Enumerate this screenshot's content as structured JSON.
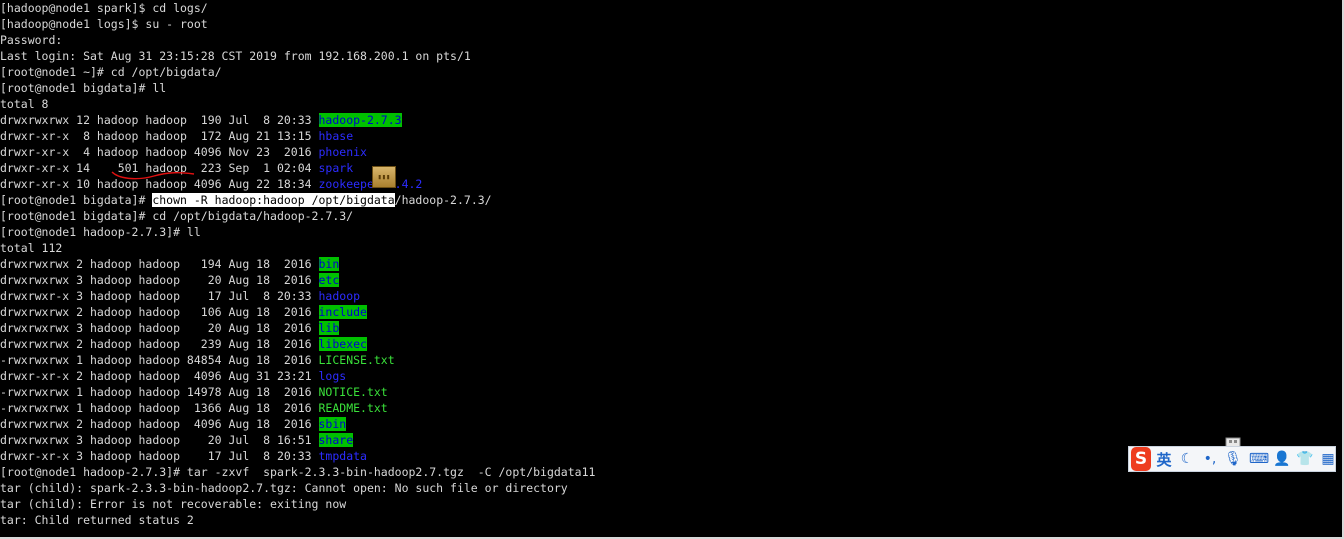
{
  "terminal": {
    "lines": [
      {
        "segments": [
          {
            "t": "[hadoop@node1 spark]$ cd logs/",
            "c": ""
          }
        ]
      },
      {
        "segments": [
          {
            "t": "[hadoop@node1 logs]$ su - root",
            "c": ""
          }
        ]
      },
      {
        "segments": [
          {
            "t": "Password:",
            "c": ""
          }
        ]
      },
      {
        "segments": [
          {
            "t": "Last login: Sat Aug 31 23:15:28 CST 2019 from 192.168.200.1 on pts/1",
            "c": ""
          }
        ]
      },
      {
        "segments": [
          {
            "t": "[root@node1 ~]# cd /opt/bigdata/",
            "c": ""
          }
        ]
      },
      {
        "segments": [
          {
            "t": "[root@node1 bigdata]# ll",
            "c": ""
          }
        ]
      },
      {
        "segments": [
          {
            "t": "total 8",
            "c": ""
          }
        ]
      },
      {
        "segments": [
          {
            "t": "drwxrwxrwx 12 hadoop hadoop  190 Jul  8 20:33 ",
            "c": ""
          },
          {
            "t": "hadoop-2.7.3",
            "c": "c-green-bg"
          }
        ]
      },
      {
        "segments": [
          {
            "t": "drwxr-xr-x  8 hadoop hadoop  172 Aug 21 13:15 ",
            "c": ""
          },
          {
            "t": "hbase",
            "c": "c-blue"
          }
        ]
      },
      {
        "segments": [
          {
            "t": "drwxr-xr-x  4 hadoop hadoop 4096 Nov 23  2016 ",
            "c": ""
          },
          {
            "t": "phoenix",
            "c": "c-blue"
          }
        ]
      },
      {
        "segments": [
          {
            "t": "drwxr-xr-x 14    501 hadoop  223 Sep  1 02:04 ",
            "c": ""
          },
          {
            "t": "spark",
            "c": "c-blue"
          }
        ]
      },
      {
        "segments": [
          {
            "t": "drwxr-xr-x 10 hadoop hadoop 4096 Aug 22 18:34 ",
            "c": ""
          },
          {
            "t": "zookeeper-3.4.2",
            "c": "c-blue"
          }
        ]
      },
      {
        "segments": [
          {
            "t": "[root@node1 bigdata]# ",
            "c": ""
          },
          {
            "t": "chown -R hadoop:hadoop /opt/bigdata",
            "c": "c-sel"
          },
          {
            "t": "/hadoop-2.7.3/",
            "c": ""
          }
        ]
      },
      {
        "segments": [
          {
            "t": "[root@node1 bigdata]# cd /opt/bigdata/hadoop-2.7.3/",
            "c": ""
          }
        ]
      },
      {
        "segments": [
          {
            "t": "[root@node1 hadoop-2.7.3]# ll",
            "c": ""
          }
        ]
      },
      {
        "segments": [
          {
            "t": "total 112",
            "c": ""
          }
        ]
      },
      {
        "segments": [
          {
            "t": "drwxrwxrwx 2 hadoop hadoop   194 Aug 18  2016 ",
            "c": ""
          },
          {
            "t": "bin",
            "c": "c-green-bg"
          }
        ]
      },
      {
        "segments": [
          {
            "t": "drwxrwxrwx 3 hadoop hadoop    20 Aug 18  2016 ",
            "c": ""
          },
          {
            "t": "etc",
            "c": "c-green-bg"
          }
        ]
      },
      {
        "segments": [
          {
            "t": "drwxrwxr-x 3 hadoop hadoop    17 Jul  8 20:33 ",
            "c": ""
          },
          {
            "t": "hadoop",
            "c": "c-blue"
          }
        ]
      },
      {
        "segments": [
          {
            "t": "drwxrwxrwx 2 hadoop hadoop   106 Aug 18  2016 ",
            "c": ""
          },
          {
            "t": "include",
            "c": "c-green-bg"
          }
        ]
      },
      {
        "segments": [
          {
            "t": "drwxrwxrwx 3 hadoop hadoop    20 Aug 18  2016 ",
            "c": ""
          },
          {
            "t": "lib",
            "c": "c-green-bg"
          }
        ]
      },
      {
        "segments": [
          {
            "t": "drwxrwxrwx 2 hadoop hadoop   239 Aug 18  2016 ",
            "c": ""
          },
          {
            "t": "libexec",
            "c": "c-green-bg"
          }
        ]
      },
      {
        "segments": [
          {
            "t": "-rwxrwxrwx 1 hadoop hadoop 84854 Aug 18  2016 ",
            "c": ""
          },
          {
            "t": "LICENSE.txt",
            "c": "c-ltgreen"
          }
        ]
      },
      {
        "segments": [
          {
            "t": "drwxr-xr-x 2 hadoop hadoop  4096 Aug 31 23:21 ",
            "c": ""
          },
          {
            "t": "logs",
            "c": "c-blue"
          }
        ]
      },
      {
        "segments": [
          {
            "t": "-rwxrwxrwx 1 hadoop hadoop 14978 Aug 18  2016 ",
            "c": ""
          },
          {
            "t": "NOTICE.txt",
            "c": "c-ltgreen"
          }
        ]
      },
      {
        "segments": [
          {
            "t": "-rwxrwxrwx 1 hadoop hadoop  1366 Aug 18  2016 ",
            "c": ""
          },
          {
            "t": "README.txt",
            "c": "c-ltgreen"
          }
        ]
      },
      {
        "segments": [
          {
            "t": "drwxrwxrwx 2 hadoop hadoop  4096 Aug 18  2016 ",
            "c": ""
          },
          {
            "t": "sbin",
            "c": "c-green-bg"
          }
        ]
      },
      {
        "segments": [
          {
            "t": "drwxrwxrwx 3 hadoop hadoop    20 Jul  8 16:51 ",
            "c": ""
          },
          {
            "t": "share",
            "c": "c-green-bg"
          }
        ]
      },
      {
        "segments": [
          {
            "t": "drwxr-xr-x 3 hadoop hadoop    17 Jul  8 20:33 ",
            "c": ""
          },
          {
            "t": "tmpdata",
            "c": "c-blue"
          }
        ]
      },
      {
        "segments": [
          {
            "t": "[root@node1 hadoop-2.7.3]# tar -zxvf  spark-2.3.3-bin-hadoop2.7.tgz  -C /opt/bigdata11",
            "c": ""
          }
        ]
      },
      {
        "segments": [
          {
            "t": "tar (child): spark-2.3.3-bin-hadoop2.7.tgz: Cannot open: No such file or directory",
            "c": ""
          }
        ]
      },
      {
        "segments": [
          {
            "t": "tar (child): Error is not recoverable: exiting now",
            "c": ""
          }
        ]
      },
      {
        "segments": [
          {
            "t": "tar: Child returned status 2",
            "c": ""
          }
        ]
      }
    ]
  },
  "ime_toolbar": {
    "logo": "S",
    "language": "英",
    "icons": [
      "moon-icon",
      "punctuation-icon",
      "microphone-icon",
      "keyboard-icon",
      "user-icon",
      "shirt-icon",
      "grid-icon"
    ],
    "accent_color": "#1f66c9",
    "logo_color": "#ee3c1f"
  },
  "overlay": {
    "folder_label": "▮▮▮"
  }
}
